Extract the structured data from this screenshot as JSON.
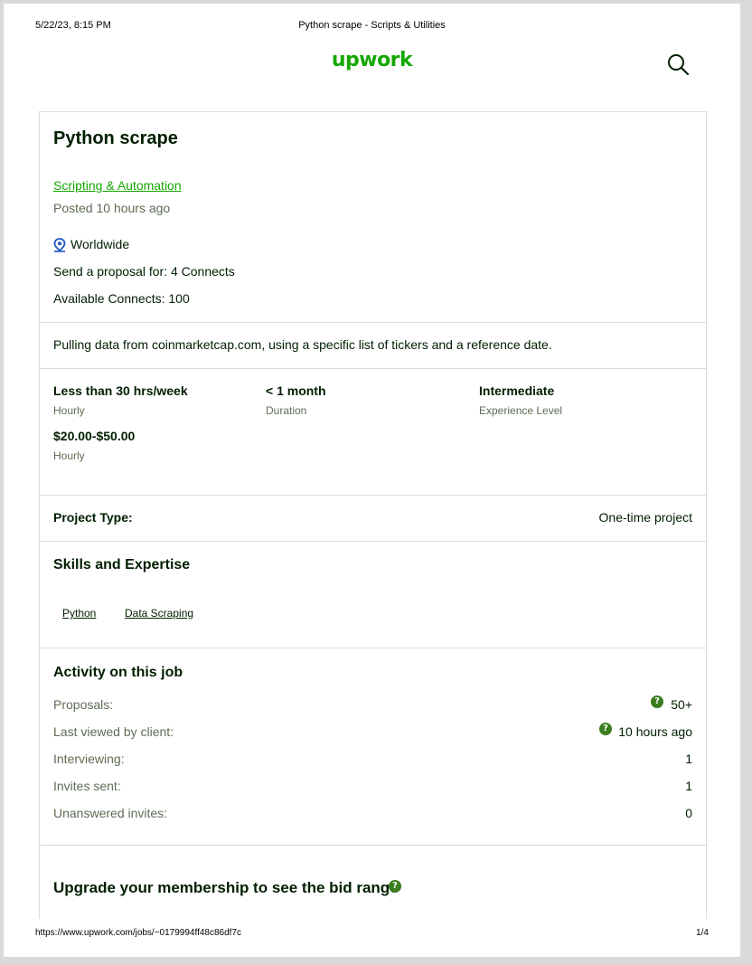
{
  "print_header": {
    "datetime": "5/22/23, 8:15 PM",
    "page_title": "Python scrape - Scripts & Utilities"
  },
  "print_footer": {
    "url": "https://www.upwork.com/jobs/~0179994ff48c86df7c",
    "page_count": "1/4"
  },
  "brand": {
    "logo_text": "upwork",
    "color": "#14a800"
  },
  "job": {
    "title": "Python scrape",
    "category": "Scripting & Automation",
    "posted": "Posted 10 hours ago",
    "location": "Worldwide",
    "proposal_cost": "Send a proposal for: 4 Connects",
    "available_connects": "Available Connects: 100",
    "description": "Pulling data from coinmarketcap.com, using a specific list of tickers and a reference date."
  },
  "details": {
    "hours": {
      "value": "Less than 30 hrs/week",
      "label": "Hourly"
    },
    "duration": {
      "value": "< 1 month",
      "label": "Duration"
    },
    "experience": {
      "value": "Intermediate",
      "label": "Experience Level"
    },
    "rate": {
      "value": "$20.00-$50.00",
      "label": "Hourly"
    }
  },
  "project_type": {
    "label": "Project Type:",
    "value": "One-time project"
  },
  "skills": {
    "heading": "Skills and Expertise",
    "items": [
      "Python",
      "Data Scraping"
    ]
  },
  "activity": {
    "heading": "Activity on this job",
    "rows": [
      {
        "label": "Proposals:",
        "value": "50+"
      },
      {
        "label": "Last viewed by client:",
        "value": "10 hours ago"
      },
      {
        "label": "Interviewing:",
        "value": "1"
      },
      {
        "label": "Invites sent:",
        "value": "1"
      },
      {
        "label": "Unanswered invites:",
        "value": "0"
      }
    ]
  },
  "upgrade": {
    "heading": "Upgrade your membership to see the bid range"
  }
}
